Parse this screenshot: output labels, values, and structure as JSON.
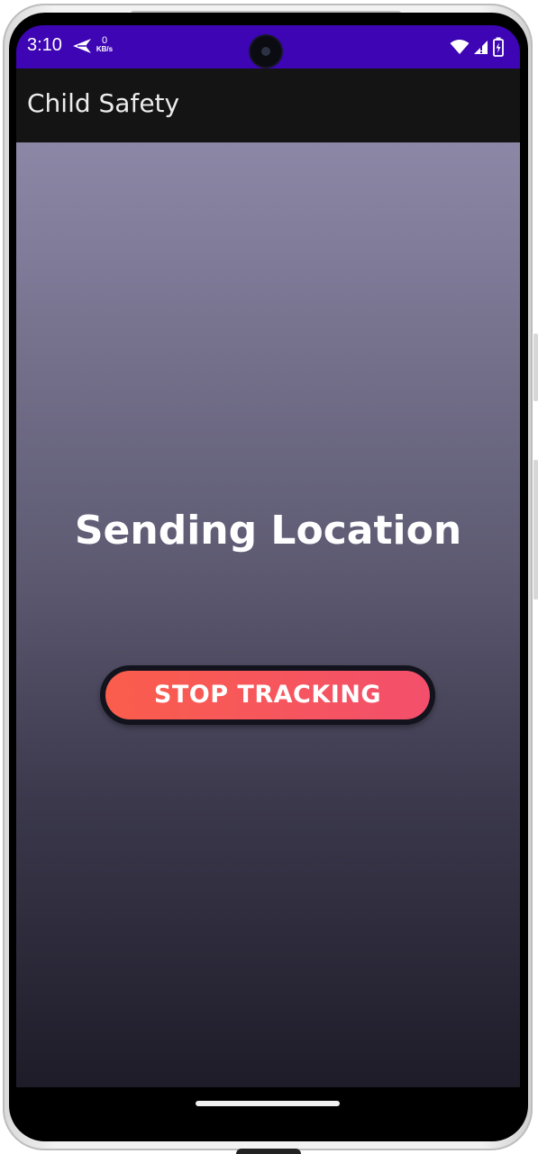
{
  "status_bar": {
    "time": "3:10",
    "network_speed_value": "0",
    "network_speed_unit": "KB/s",
    "icons": [
      "send-icon",
      "wifi-icon",
      "signal-icon",
      "battery-charging-icon"
    ],
    "background_color": "#3d05b3"
  },
  "app_bar": {
    "title": "Child Safety"
  },
  "main": {
    "heading": "Sending Location",
    "stop_button_label": "STOP TRACKING",
    "button_colors": [
      "#fa5d4c",
      "#f34f6c"
    ]
  }
}
